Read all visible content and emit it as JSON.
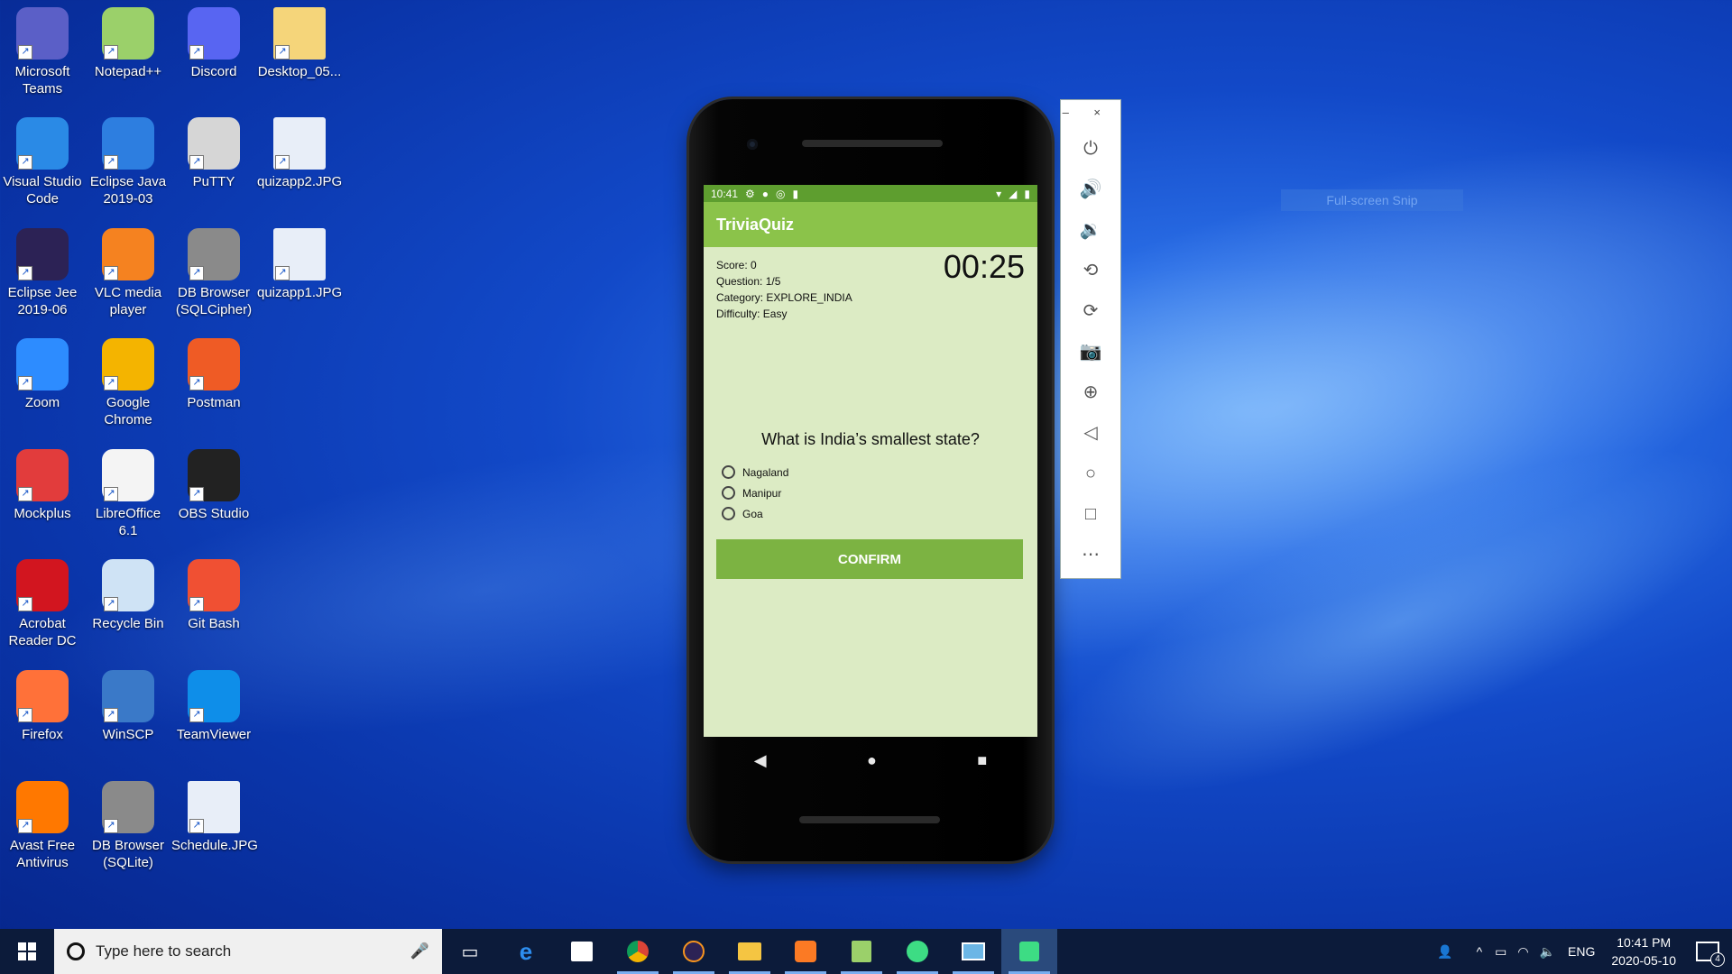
{
  "desktop": {
    "icons": [
      {
        "label": "Microsoft Teams",
        "icon": "teams-icon"
      },
      {
        "label": "Notepad++",
        "icon": "notepadpp-icon"
      },
      {
        "label": "Discord",
        "icon": "discord-icon"
      },
      {
        "label": "Desktop_05...",
        "icon": "folder-icon"
      },
      {
        "label": "Visual Studio Code",
        "icon": "vscode-icon"
      },
      {
        "label": "Eclipse Java 2019-03",
        "icon": "eclipse-java-icon"
      },
      {
        "label": "PuTTY",
        "icon": "putty-icon"
      },
      {
        "label": "quizapp2.JPG",
        "icon": "image-file-icon"
      },
      {
        "label": "Eclipse Jee 2019-06",
        "icon": "eclipse-jee-icon"
      },
      {
        "label": "VLC media player",
        "icon": "vlc-icon"
      },
      {
        "label": "DB Browser (SQLCipher)",
        "icon": "db-browser-icon"
      },
      {
        "label": "quizapp1.JPG",
        "icon": "image-file-icon"
      },
      {
        "label": "Zoom",
        "icon": "zoom-icon"
      },
      {
        "label": "Google Chrome",
        "icon": "chrome-icon"
      },
      {
        "label": "Postman",
        "icon": "postman-icon"
      },
      {
        "label": "Mockplus",
        "icon": "mockplus-icon"
      },
      {
        "label": "LibreOffice 6.1",
        "icon": "libreoffice-icon"
      },
      {
        "label": "OBS Studio",
        "icon": "obs-icon"
      },
      {
        "label": "Acrobat Reader DC",
        "icon": "acrobat-icon"
      },
      {
        "label": "Recycle Bin",
        "icon": "recycle-bin-icon"
      },
      {
        "label": "Git Bash",
        "icon": "git-icon"
      },
      {
        "label": "Firefox",
        "icon": "firefox-icon"
      },
      {
        "label": "WinSCP",
        "icon": "winscp-icon"
      },
      {
        "label": "TeamViewer",
        "icon": "teamviewer-icon"
      },
      {
        "label": "Avast Free Antivirus",
        "icon": "avast-icon"
      },
      {
        "label": "DB Browser (SQLite)",
        "icon": "db-browser-icon"
      },
      {
        "label": "Schedule.JPG",
        "icon": "image-file-icon"
      }
    ]
  },
  "phone": {
    "status_time": "10:41",
    "app_title": "TriviaQuiz",
    "score": "Score: 0",
    "question_count": "Question: 1/5",
    "category": "Category: EXPLORE_INDIA",
    "difficulty": "Difficulty: Easy",
    "timer": "00:25",
    "question": "What is India’s smallest state?",
    "options": [
      "Nagaland",
      "Manipur",
      "Goa"
    ],
    "confirm_label": "CONFIRM"
  },
  "emulator_toolbar": {
    "window_controls": "– ×",
    "buttons": [
      "power-icon",
      "volume-up-icon",
      "volume-down-icon",
      "rotate-left-icon",
      "rotate-right-icon",
      "camera-icon",
      "zoom-icon",
      "back-icon",
      "home-icon",
      "overview-icon",
      "more-icon"
    ]
  },
  "ghost_text": "Full-screen Snip",
  "taskbar": {
    "search_placeholder": "Type here to search",
    "apps": [
      "task-view-icon",
      "edge-icon",
      "store-icon",
      "chrome-icon",
      "eclipse-icon",
      "file-explorer-icon",
      "xampp-icon",
      "notepadpp-icon",
      "android-studio-icon",
      "control-panel-icon",
      "emulator-icon"
    ],
    "language": "ENG",
    "time": "10:41 PM",
    "date": "2020-05-10",
    "notification_count": "4"
  }
}
